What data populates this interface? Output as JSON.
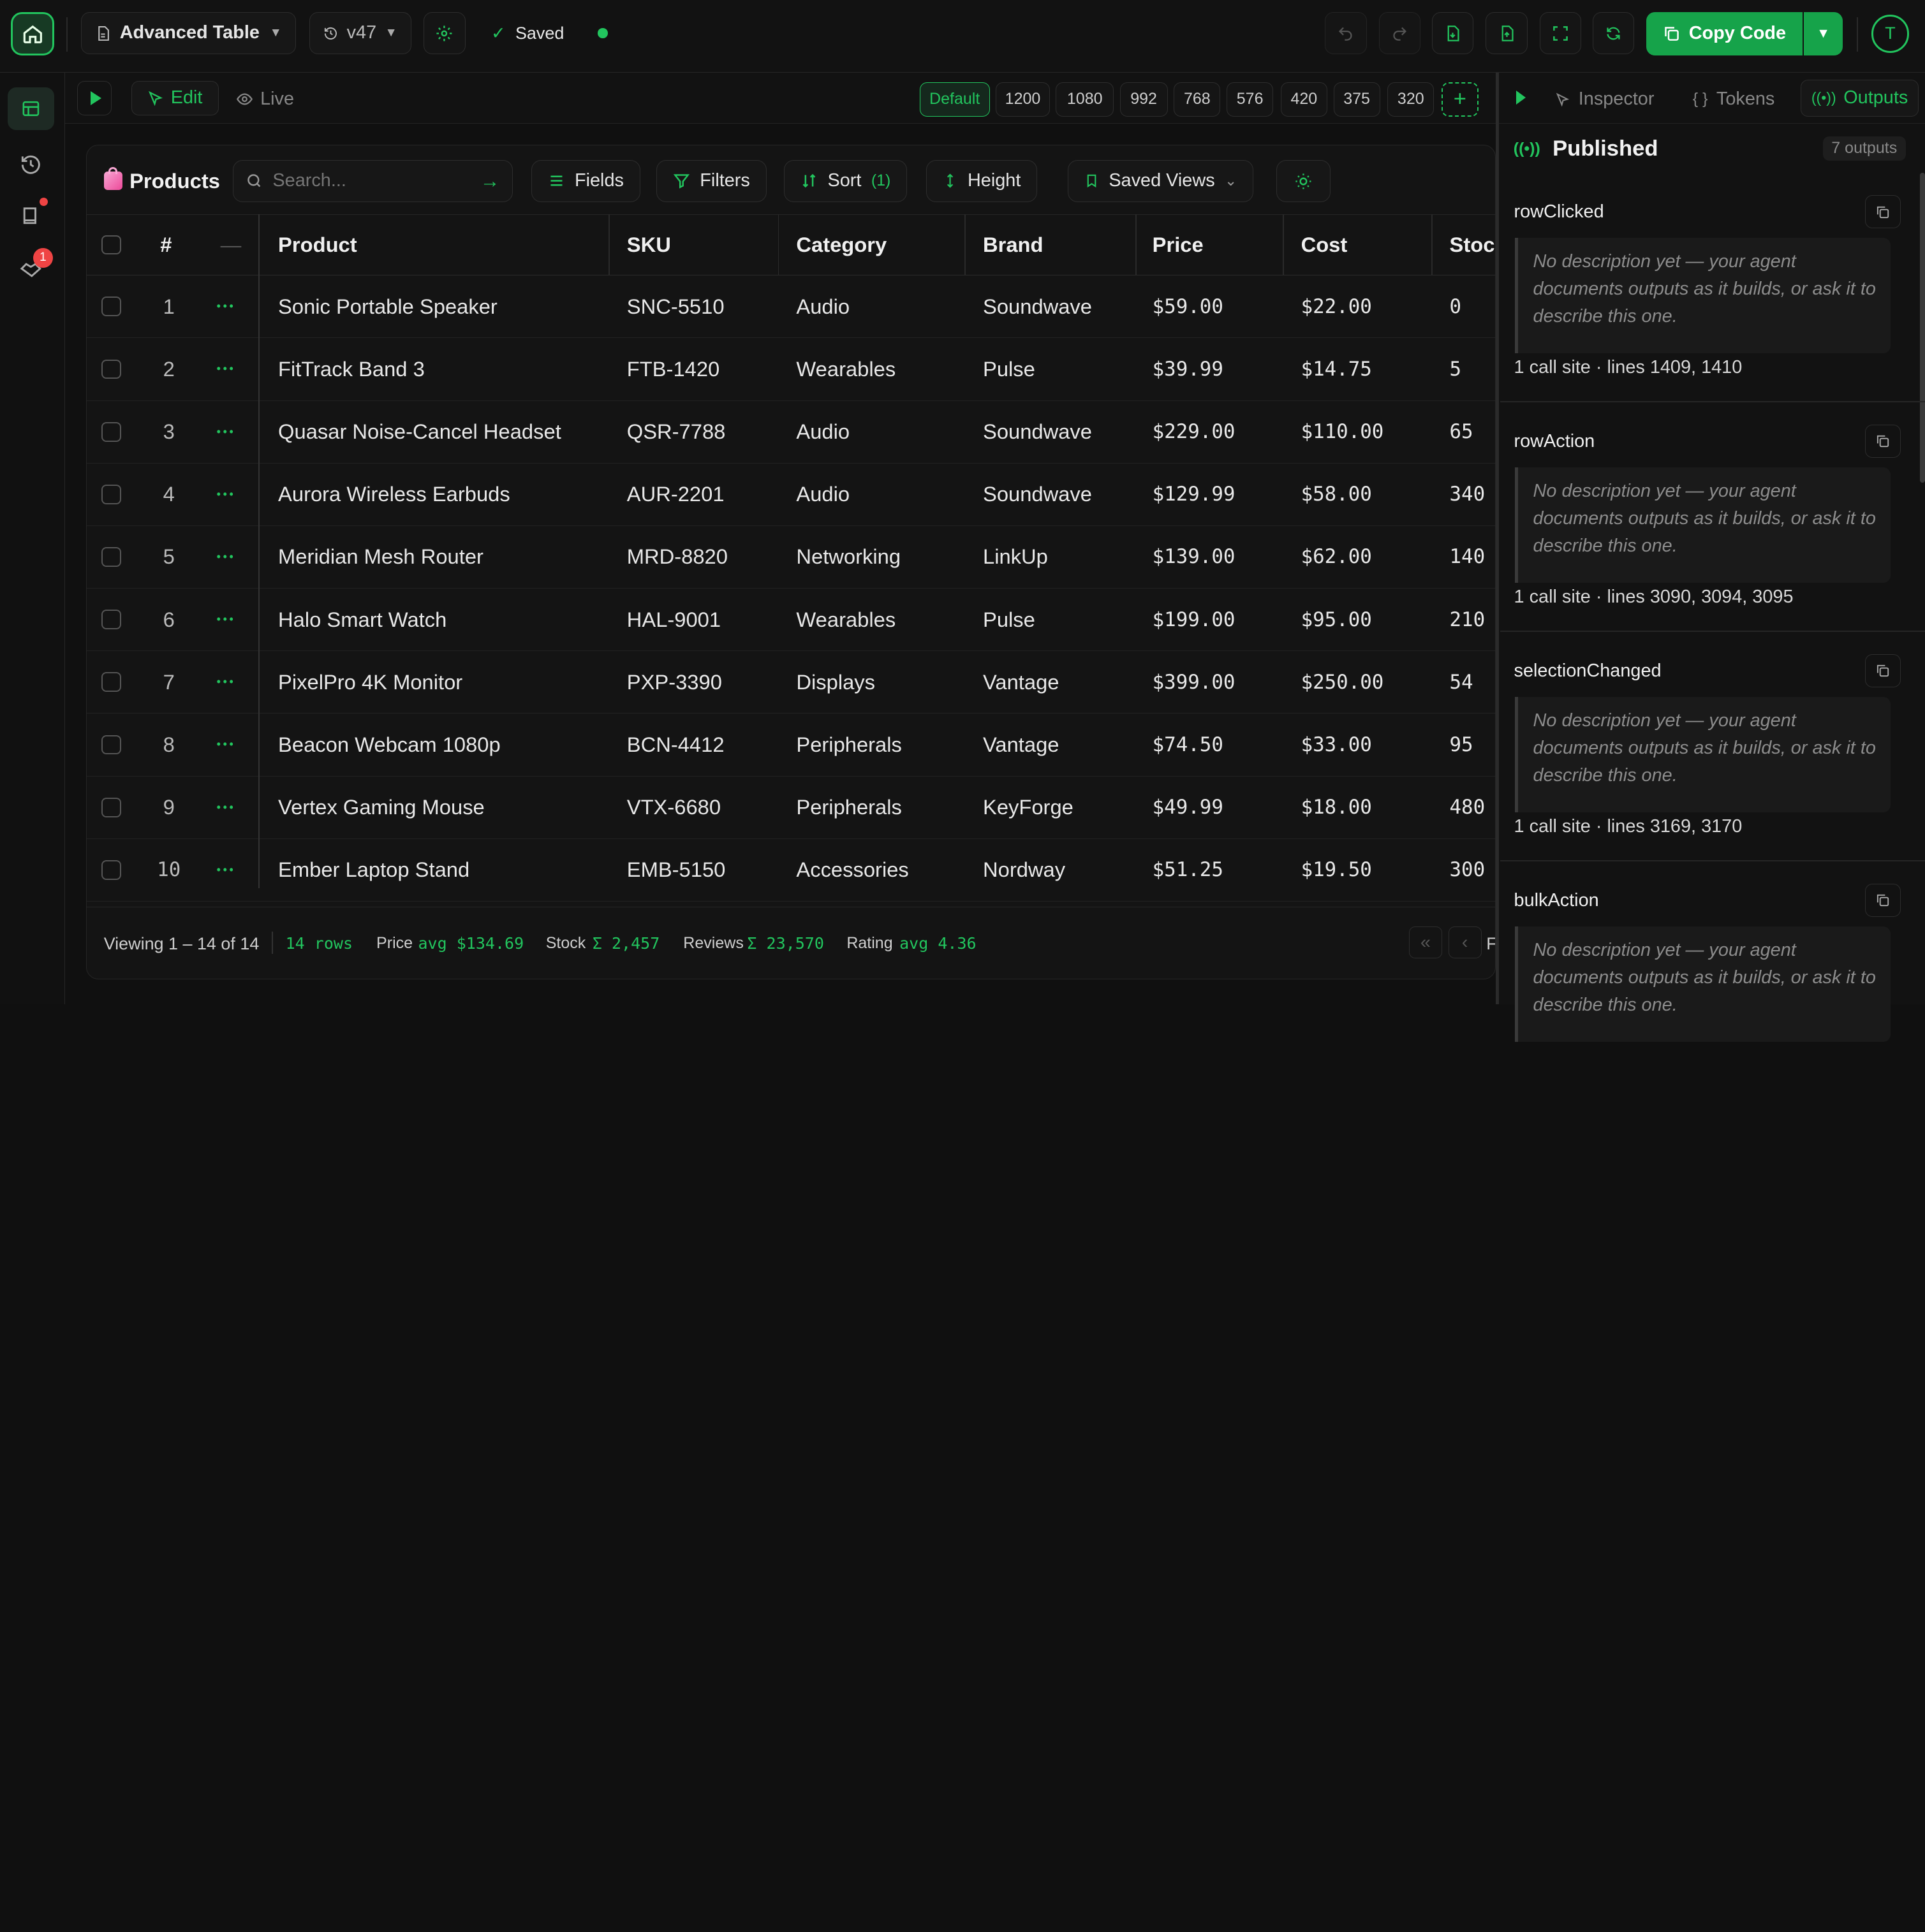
{
  "topbar": {
    "project_name": "Advanced Table",
    "version": "v47",
    "saved_label": "Saved",
    "copy_code_label": "Copy Code",
    "avatar_initial": "T"
  },
  "sidebar": {
    "notification_badge": "1"
  },
  "subbar": {
    "edit_label": "Edit",
    "live_label": "Live",
    "breakpoints": [
      "Default",
      "1200",
      "1080",
      "992",
      "768",
      "576",
      "420",
      "375",
      "320"
    ]
  },
  "table": {
    "title": "Products",
    "search_placeholder": "Search...",
    "toolbar": {
      "fields": "Fields",
      "filters": "Filters",
      "sort": "Sort",
      "sort_count": "(1)",
      "height": "Height",
      "saved_views": "Saved Views"
    },
    "columns": [
      "#",
      "Product",
      "SKU",
      "Category",
      "Brand",
      "Price",
      "Cost",
      "Stoc"
    ],
    "rows": [
      {
        "num": "1",
        "product": "Sonic Portable Speaker",
        "sku": "SNC-5510",
        "category": "Audio",
        "brand": "Soundwave",
        "price": "$59.00",
        "cost": "$22.00",
        "stock": "0"
      },
      {
        "num": "2",
        "product": "FitTrack Band 3",
        "sku": "FTB-1420",
        "category": "Wearables",
        "brand": "Pulse",
        "price": "$39.99",
        "cost": "$14.75",
        "stock": "5"
      },
      {
        "num": "3",
        "product": "Quasar Noise-Cancel Headset",
        "sku": "QSR-7788",
        "category": "Audio",
        "brand": "Soundwave",
        "price": "$229.00",
        "cost": "$110.00",
        "stock": "65"
      },
      {
        "num": "4",
        "product": "Aurora Wireless Earbuds",
        "sku": "AUR-2201",
        "category": "Audio",
        "brand": "Soundwave",
        "price": "$129.99",
        "cost": "$58.00",
        "stock": "340"
      },
      {
        "num": "5",
        "product": "Meridian Mesh Router",
        "sku": "MRD-8820",
        "category": "Networking",
        "brand": "LinkUp",
        "price": "$139.00",
        "cost": "$62.00",
        "stock": "140"
      },
      {
        "num": "6",
        "product": "Halo Smart Watch",
        "sku": "HAL-9001",
        "category": "Wearables",
        "brand": "Pulse",
        "price": "$199.00",
        "cost": "$95.00",
        "stock": "210"
      },
      {
        "num": "7",
        "product": "PixelPro 4K Monitor",
        "sku": "PXP-3390",
        "category": "Displays",
        "brand": "Vantage",
        "price": "$399.00",
        "cost": "$250.00",
        "stock": "54"
      },
      {
        "num": "8",
        "product": "Beacon Webcam 1080p",
        "sku": "BCN-4412",
        "category": "Peripherals",
        "brand": "Vantage",
        "price": "$74.50",
        "cost": "$33.00",
        "stock": "95"
      },
      {
        "num": "9",
        "product": "Vertex Gaming Mouse",
        "sku": "VTX-6680",
        "category": "Peripherals",
        "brand": "KeyForge",
        "price": "$49.99",
        "cost": "$18.00",
        "stock": "480"
      },
      {
        "num": "10",
        "product": "Ember Laptop Stand",
        "sku": "EMB-5150",
        "category": "Accessories",
        "brand": "Nordway",
        "price": "$51.25",
        "cost": "$19.50",
        "stock": "300"
      }
    ],
    "footer": {
      "viewing": "Viewing 1 – 14 of 14",
      "rows": "14 rows",
      "price_label": "Price",
      "price_value": "avg $134.69",
      "stock_label": "Stock",
      "stock_value": "Σ 2,457",
      "reviews_label": "Reviews",
      "reviews_value": "Σ 23,570",
      "rating_label": "Rating",
      "rating_value": "avg 4.36",
      "page_cut": "F"
    }
  },
  "panel": {
    "tabs": {
      "inspector": "Inspector",
      "tokens": "Tokens",
      "outputs": "Outputs"
    },
    "heading": "Published",
    "count": "7 outputs",
    "outputs": [
      {
        "name": "rowClicked",
        "description": "No description yet — your agent documents outputs as it builds, or ask it to describe this one.",
        "calls": "1 call site · lines 1409, 1410"
      },
      {
        "name": "rowAction",
        "description": "No description yet — your agent documents outputs as it builds, or ask it to describe this one.",
        "calls": "1 call site · lines 3090, 3094, 3095"
      },
      {
        "name": "selectionChanged",
        "description": "No description yet — your agent documents outputs as it builds, or ask it to describe this one.",
        "calls": "1 call site · lines 3169, 3170"
      },
      {
        "name": "bulkAction",
        "description": "No description yet — your agent documents outputs as it builds, or ask it to describe this one.",
        "calls": ""
      }
    ]
  },
  "colors": {
    "accent": "#22c55e",
    "accent_button": "#16a34a",
    "background": "#101010"
  }
}
